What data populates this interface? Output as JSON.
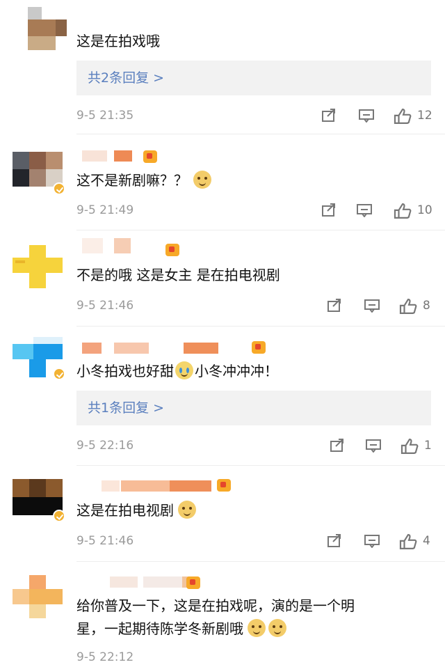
{
  "comments": [
    {
      "text": "这是在拍戏哦",
      "reply": "共2条回复 >",
      "time": "9-5 21:35",
      "likes": "12"
    },
    {
      "text": "这不是新剧嘛？？",
      "time": "9-5 21:49",
      "likes": "10"
    },
    {
      "text": "不是的哦  这是女主 是在拍电视剧",
      "time": "9-5 21:46",
      "likes": "8"
    },
    {
      "text_a": "小冬拍戏也好甜",
      "text_b": "小冬冲冲冲！",
      "reply": "共1条回复 >",
      "time": "9-5 22:16",
      "likes": "1"
    },
    {
      "text": "这是在拍电视剧",
      "time": "9-5 21:46",
      "likes": "4"
    },
    {
      "line1": "给你普及一下，这是在拍戏呢，演的是一个明",
      "line2": "星，一起期待陈学冬新剧哦",
      "time": "9-5 22:12"
    }
  ],
  "icons": {
    "share": "share-icon",
    "comment": "comment-icon",
    "like": "thumbs-up-icon",
    "emoji": "doge-emoji-icon",
    "crying": "crying-emoji-icon",
    "verified": "verified-badge-icon",
    "vip": "vip-badge-icon"
  },
  "colors": {
    "reply_link": "#5a7fbe",
    "meta_gray": "#9a9a9a",
    "badge": "#f2b233"
  }
}
